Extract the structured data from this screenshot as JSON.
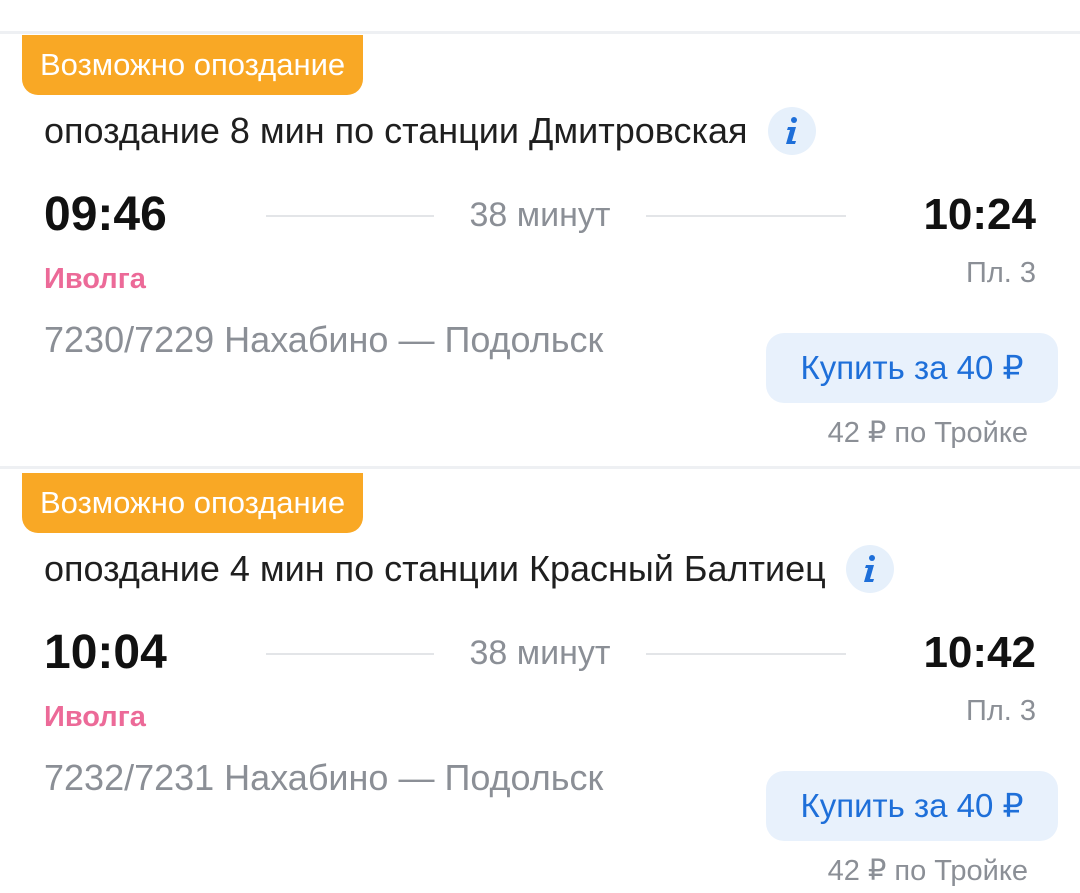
{
  "trains": [
    {
      "badge": "Возможно опоздание",
      "delay_text": "опоздание 8 мин по станции Дмитровская",
      "info_icon": "info-icon",
      "departure": "09:46",
      "duration": "38 минут",
      "arrival": "10:24",
      "train_type": "Иволга",
      "platform": "Пл. 3",
      "route": "7230/7229 Нахабино — Подольск",
      "buy_label": "Купить за 40 ₽",
      "troika_price": "42 ₽ по Тройке"
    },
    {
      "badge": "Возможно опоздание",
      "delay_text": "опоздание 4 мин по станции Красный Балтиец",
      "info_icon": "info-icon",
      "departure": "10:04",
      "duration": "38 минут",
      "arrival": "10:42",
      "train_type": "Иволга",
      "platform": "Пл. 3",
      "route": "7232/7231 Нахабино — Подольск",
      "buy_label": "Купить за 40 ₽",
      "troika_price": "42 ₽ по Тройке"
    }
  ],
  "colors": {
    "badge": "#f9a825",
    "train_type": "#ec6a98",
    "buy_text": "#1e6fd9",
    "buy_bg": "#e8f1fc",
    "muted_text": "#8b8f96"
  }
}
